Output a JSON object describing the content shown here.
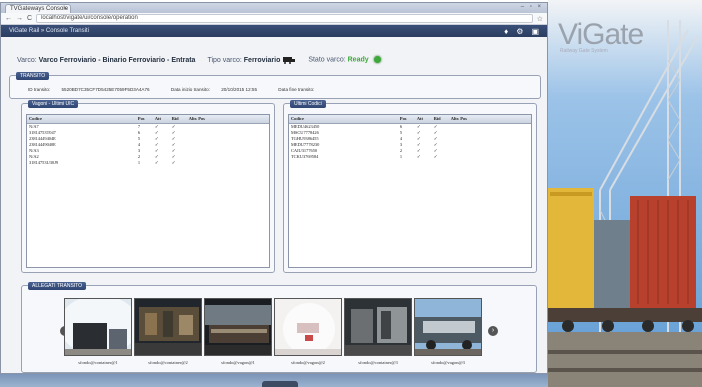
{
  "browser": {
    "tab_title": "TVGateways Console",
    "tab_close": "×",
    "window_controls": "– ▫ ×",
    "url": "localhost/vigate/ui/console/operation",
    "app_breadcrumb": "ViGate Rail » Console Transiti",
    "back": "←",
    "forward": "→",
    "reload": "C"
  },
  "info": {
    "gate_label": "Varco:",
    "gate_value": "Varco Ferroviario - Binario Ferroviario - Entrata",
    "type_label": "Tipo varco:",
    "type_value": "Ferroviario",
    "state_label": "Stato varco:",
    "state_value": "Ready"
  },
  "transit": {
    "title": "TRANSITO",
    "id_label": "ID transito:",
    "id_value": "5520BD7C35CF7D5425E7059F5D3A4A76",
    "start_label": "Data inizio transito:",
    "start_value": "20/10/2015 12:55",
    "end_label": "Data fine transito:",
    "end_value": ""
  },
  "wagons": {
    "title": "Vagoni - Ultimi UIC",
    "headers": [
      "Codice",
      "Pos",
      "Att",
      "Rid",
      "Altr. Pos"
    ],
    "rows": [
      [
        "N/A7",
        "7",
        "✓",
        "✓",
        ""
      ],
      [
        "31814753T047",
        "6",
        "✓",
        "✓",
        ""
      ],
      [
        "23814449404E",
        "5",
        "✓",
        "✓",
        ""
      ],
      [
        "23814449040E",
        "4",
        "✓",
        "✓",
        ""
      ],
      [
        "N/A3",
        "3",
        "✓",
        "✓",
        ""
      ],
      [
        "N/A2",
        "2",
        "✓",
        "✓",
        ""
      ],
      [
        "31814753U30J9",
        "1",
        "✓",
        "✓",
        ""
      ]
    ]
  },
  "codes": {
    "title": "Ultimi Codici",
    "headers": [
      "Codice",
      "Pos",
      "Att",
      "Rid",
      "Altr. Pos"
    ],
    "rows": [
      [
        "MEDU4623450",
        "6",
        "✓",
        "✓",
        ""
      ],
      [
        "MSCU7778426",
        "5",
        "✓",
        "✓",
        ""
      ],
      [
        "TGHU9386455",
        "4",
        "✓",
        "✓",
        ""
      ],
      [
        "MEDU7778230",
        "3",
        "✓",
        "✓",
        ""
      ],
      [
        "CAIU3177650",
        "2",
        "✓",
        "✓",
        ""
      ],
      [
        "TCKU3769584",
        "1",
        "✓",
        "✓",
        ""
      ]
    ]
  },
  "attachments": {
    "title": "ALLEGATI TRANSITO",
    "prev": "‹",
    "next": "›",
    "items": [
      {
        "caption": "sfondo@container@1"
      },
      {
        "caption": "sfondo@container@2"
      },
      {
        "caption": "sfondo@vagon@1"
      },
      {
        "caption": "sfondo@vagon@2"
      },
      {
        "caption": "sfondo@container@3"
      },
      {
        "caption": "sfondo@vagon@3"
      }
    ]
  },
  "photo": {
    "logo": "ViGate",
    "tagline": "Railway Gate System"
  },
  "colors": {
    "header": "#2b3d60",
    "ready": "#3fa83a",
    "panel_title": "#3a5282"
  }
}
